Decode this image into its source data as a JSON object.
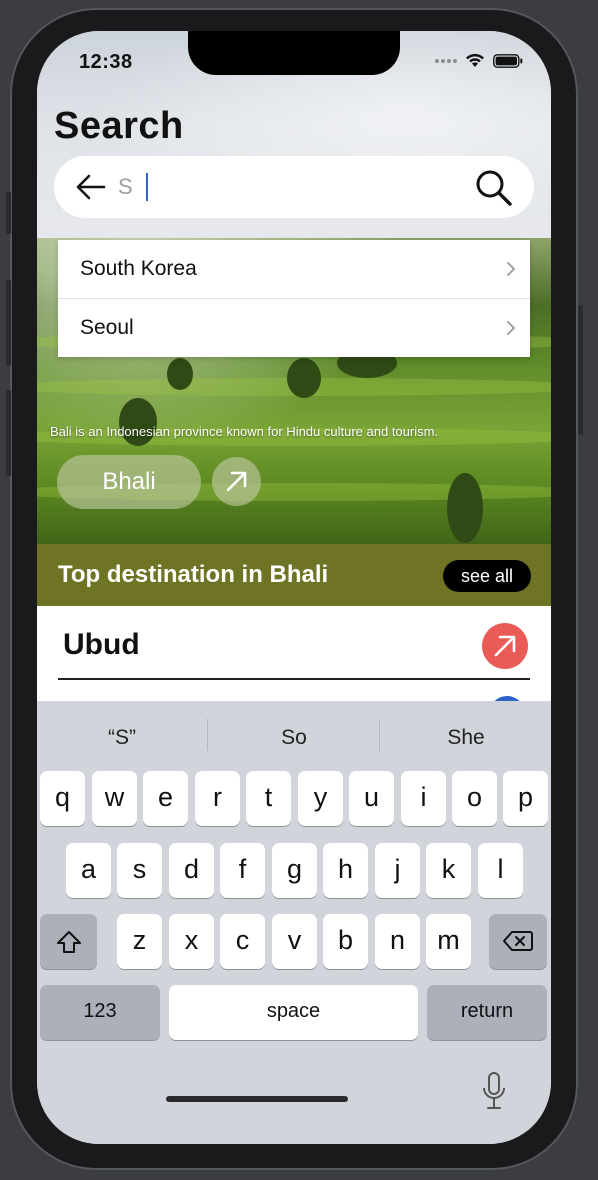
{
  "status": {
    "time": "12:38"
  },
  "page": {
    "title": "Search"
  },
  "search": {
    "value": "S",
    "placeholder": ""
  },
  "suggestions_dropdown": [
    {
      "label": "South Korea"
    },
    {
      "label": "Seoul"
    }
  ],
  "hero": {
    "description": "Bali is an Indonesian province known for Hindu culture and tourism.",
    "button_label": "Bhali"
  },
  "section": {
    "title": "Top destination in Bhali",
    "see_all_label": "see all"
  },
  "destinations": [
    {
      "name": "Ubud"
    }
  ],
  "keyboard": {
    "suggestions": [
      "“S”",
      "So",
      "She"
    ],
    "row1": [
      "q",
      "w",
      "e",
      "r",
      "t",
      "y",
      "u",
      "i",
      "o",
      "p"
    ],
    "row2": [
      "a",
      "s",
      "d",
      "f",
      "g",
      "h",
      "j",
      "k",
      "l"
    ],
    "row3": [
      "z",
      "x",
      "c",
      "v",
      "b",
      "n",
      "m"
    ],
    "numbers_label": "123",
    "space_label": "space",
    "return_label": "return"
  },
  "colors": {
    "band": "#6e7424",
    "dest_arrow": "#ea5a57",
    "caret": "#2d63c8"
  }
}
